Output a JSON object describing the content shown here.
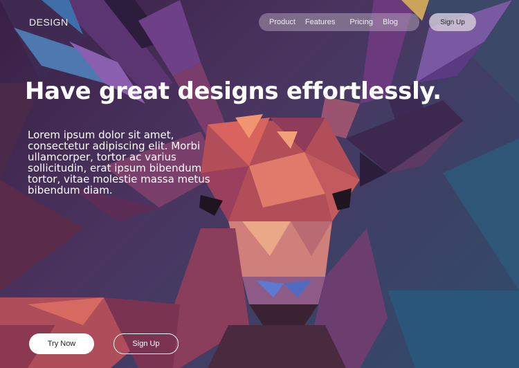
{
  "brand": {
    "logo_text": "DESIGN"
  },
  "nav": {
    "items": [
      {
        "label": "Product"
      },
      {
        "label": "Features"
      },
      {
        "label": "Pricing"
      },
      {
        "label": "Blog"
      }
    ],
    "signup_label": "Sign Up"
  },
  "hero": {
    "headline": "Have great designs effortlessly.",
    "body": "Lorem ipsum dolor sit amet, consectetur adipiscing elit. Morbi ullamcorper, tortor ac varius sollicitudin, erat ipsum bibendum tortor, vitae molestie massa metus bibendum diam.",
    "primary_cta": "Try Now",
    "secondary_cta": "Sign Up"
  },
  "colors": {
    "background_top_left": "#3a1f45",
    "background_bottom_right": "#2f4d6c",
    "primary_button": "#ffffff",
    "text": "#ffffff"
  },
  "background_image": {
    "subject": "low-poly deer illustration"
  }
}
